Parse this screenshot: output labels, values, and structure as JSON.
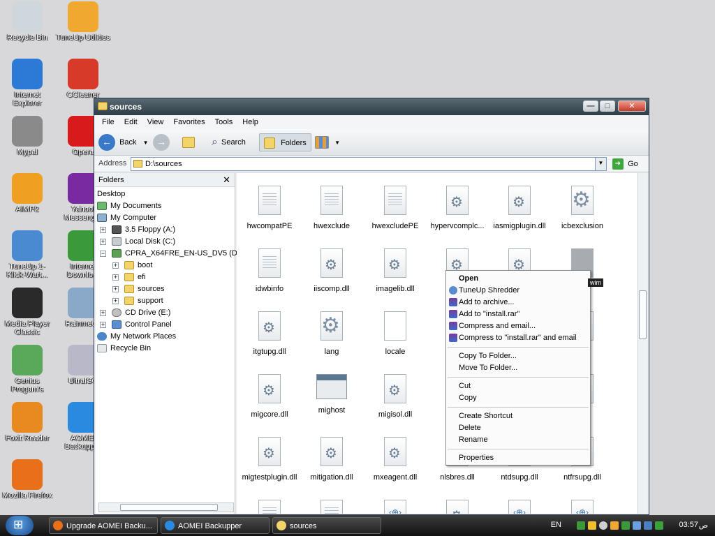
{
  "desktop": {
    "icons": [
      {
        "label": "Recycle Bin",
        "icon": "recycle-bin-icon",
        "color": "#cfd6dc"
      },
      {
        "label": "TuneUp Utilities",
        "icon": "tuneup-icon",
        "color": "#f0a830"
      },
      {
        "label": "Internet Explorer",
        "icon": "ie-icon",
        "color": "#2c7ad6"
      },
      {
        "label": "CCleaner",
        "icon": "ccleaner-icon",
        "color": "#d83a2a"
      },
      {
        "label": "Mypal",
        "icon": "mypal-icon",
        "color": "#8a8a8a"
      },
      {
        "label": "Opera",
        "icon": "opera-icon",
        "color": "#d81a1a"
      },
      {
        "label": "AIMP2",
        "icon": "aimp-icon",
        "color": "#f0a020"
      },
      {
        "label": "Yahoo! Messenger",
        "icon": "yahoo-icon",
        "color": "#7a2aa0"
      },
      {
        "label": "TuneUp 1-Klick-Wart...",
        "icon": "tuneup-oneclick-icon",
        "color": "#4a8ad0"
      },
      {
        "label": "Internet Downlo...",
        "icon": "idm-icon",
        "color": "#3a9a3a"
      },
      {
        "label": "Media Player Classic",
        "icon": "mpc-icon",
        "color": "#2a2a2a"
      },
      {
        "label": "Rainmeter",
        "icon": "rainmeter-icon",
        "color": "#8aa8c8"
      },
      {
        "label": "Genius Progam's",
        "icon": "genius-icon",
        "color": "#5aa85a"
      },
      {
        "label": "UltraISO",
        "icon": "ultraiso-icon",
        "color": "#b8b8c8"
      },
      {
        "label": "Foxit Reader",
        "icon": "foxit-icon",
        "color": "#e88a20"
      },
      {
        "label": "AOMEI Backupper",
        "icon": "aomei-icon",
        "color": "#2a8ae0"
      },
      {
        "label": "Mozilla Firefox",
        "icon": "firefox-icon",
        "color": "#e8701a"
      }
    ]
  },
  "window": {
    "title": "sources",
    "menu": [
      "File",
      "Edit",
      "View",
      "Favorites",
      "Tools",
      "Help"
    ],
    "toolbar": {
      "back": "Back",
      "search": "Search",
      "folders": "Folders"
    },
    "address": {
      "label": "Address",
      "value": "D:\\sources",
      "go": "Go"
    },
    "folders_pane": {
      "title": "Folders",
      "close": "✕",
      "items": [
        {
          "label": "Desktop",
          "icon": "desktop"
        },
        {
          "label": "My Documents",
          "icon": "docs"
        },
        {
          "label": "My Computer",
          "icon": "comp"
        },
        {
          "label": "3.5 Floppy (A:)",
          "icon": "floppy",
          "pm": "+"
        },
        {
          "label": "Local Disk (C:)",
          "icon": "drive",
          "pm": "+"
        },
        {
          "label": "CPRA_X64FRE_EN-US_DV5 (D:)",
          "icon": "dvd",
          "pm": "−"
        },
        {
          "label": "boot",
          "icon": "folder",
          "pm": "+"
        },
        {
          "label": "efi",
          "icon": "folder",
          "pm": "+"
        },
        {
          "label": "sources",
          "icon": "folder",
          "pm": "+"
        },
        {
          "label": "support",
          "icon": "folder",
          "pm": "+"
        },
        {
          "label": "CD Drive (E:)",
          "icon": "cd",
          "pm": "+"
        },
        {
          "label": "Control Panel",
          "icon": "cpl",
          "pm": "+"
        },
        {
          "label": "My Network Places",
          "icon": "net"
        },
        {
          "label": "Recycle Bin",
          "icon": "bin"
        }
      ]
    },
    "files": [
      {
        "label": "hwcompatPE",
        "type": "doc"
      },
      {
        "label": "hwexclude",
        "type": "doc"
      },
      {
        "label": "hwexcludePE",
        "type": "doc"
      },
      {
        "label": "hypervcomplc...",
        "type": "dll"
      },
      {
        "label": "iasmigplugin.dll",
        "type": "dll"
      },
      {
        "label": "icbexclusion",
        "type": "cfg"
      },
      {
        "label": "idwbinfo",
        "type": "doc"
      },
      {
        "label": "iiscomp.dll",
        "type": "dll"
      },
      {
        "label": "imagelib.dll",
        "type": "dll"
      },
      {
        "label": "imag",
        "type": "dll"
      },
      {
        "label": "",
        "type": "dll"
      },
      {
        "label": "",
        "type": "grey"
      },
      {
        "label": "itgtupg.dll",
        "type": "dll"
      },
      {
        "label": "lang",
        "type": "cfg"
      },
      {
        "label": "locale",
        "type": "blank"
      },
      {
        "label": "logp",
        "type": "dll"
      },
      {
        "label": "",
        "type": "none"
      },
      {
        "label": "p",
        "type": "doc"
      },
      {
        "label": "migcore.dll",
        "type": "dll"
      },
      {
        "label": "mighost",
        "type": "app"
      },
      {
        "label": "migisol.dll",
        "type": "dll"
      },
      {
        "label": "n",
        "type": "none"
      },
      {
        "label": "",
        "type": "none"
      },
      {
        "label": ".dll",
        "type": "dll"
      },
      {
        "label": "migtestplugin.dll",
        "type": "dll"
      },
      {
        "label": "mitigation.dll",
        "type": "dll"
      },
      {
        "label": "mxeagent.dll",
        "type": "dll"
      },
      {
        "label": "nlsbres.dll",
        "type": "dll"
      },
      {
        "label": "ntdsupg.dll",
        "type": "dll"
      },
      {
        "label": "ntfrsupg.dll",
        "type": "dll"
      },
      {
        "label": "",
        "type": "doc"
      },
      {
        "label": "",
        "type": "doc"
      },
      {
        "label": "",
        "type": "web"
      },
      {
        "label": "",
        "type": "dll"
      },
      {
        "label": "",
        "type": "web"
      },
      {
        "label": "",
        "type": "web"
      }
    ],
    "tooltip": "wim"
  },
  "context_menu": {
    "items": [
      {
        "label": "Open",
        "bold": true
      },
      {
        "label": "TuneUp Shredder",
        "icon": "shred"
      },
      {
        "label": "Add to archive...",
        "icon": "rar"
      },
      {
        "label": "Add to \"install.rar\"",
        "icon": "rar"
      },
      {
        "label": "Compress and email...",
        "icon": "rar"
      },
      {
        "label": "Compress to \"install.rar\" and email",
        "icon": "rar"
      },
      {
        "sep": true
      },
      {
        "label": "Copy To Folder..."
      },
      {
        "label": "Move To Folder..."
      },
      {
        "sep": true
      },
      {
        "label": "Cut"
      },
      {
        "label": "Copy"
      },
      {
        "sep": true
      },
      {
        "label": "Create Shortcut"
      },
      {
        "label": "Delete"
      },
      {
        "label": "Rename"
      },
      {
        "sep": true
      },
      {
        "label": "Properties"
      }
    ]
  },
  "taskbar": {
    "buttons": [
      {
        "label": "Upgrade AOMEI Backu...",
        "icon_color": "#e8701a"
      },
      {
        "label": "AOMEI Backupper",
        "icon_color": "#2a8ae0"
      },
      {
        "label": "sources",
        "icon_color": "#f2d46b"
      }
    ],
    "lang": "EN",
    "time": "03:57",
    "ampm": "ص"
  }
}
